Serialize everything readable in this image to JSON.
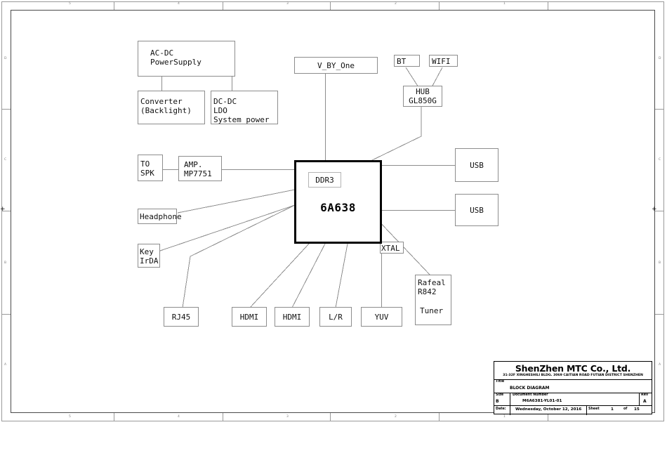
{
  "sheet": {
    "frame": {
      "columns": [
        "5",
        "4",
        "3",
        "2",
        "1"
      ],
      "rows": [
        "D",
        "C",
        "B",
        "A"
      ]
    }
  },
  "diagram": {
    "title": "BLOCK DIAGRAM",
    "soc": {
      "name": "6A638",
      "memory_label": "DDR3"
    },
    "blocks": {
      "acdc": "AC-DC\nPowerSupply",
      "converter": "Converter\n(Backlight)",
      "dcdc": "DC-DC\nLDO\nSystem power",
      "vbyone": "V_BY_One",
      "bt": "BT",
      "wifi": "WIFI",
      "hub": "HUB\nGL850G",
      "to_spk": "TO\nSPK",
      "amp": "AMP.\nMP7751",
      "headphone": "Headphone",
      "key_irda": "Key\nIrDA",
      "rj45": "RJ45",
      "hdmi1": "HDMI",
      "hdmi2": "HDMI",
      "lr": "L/R",
      "yuv": "YUV",
      "usb1": "USB",
      "usb2": "USB",
      "xtal": "XTAL",
      "tuner_name": "Rafeal\nR842",
      "tuner_type": "Tuner"
    }
  },
  "title_block": {
    "company": "ShenZhen MTC Co., Ltd.",
    "address": "31-32F XINGHESHILI BLDG. 3069 CAITIAN ROAD FUTIAN DISTRICT SHENZHEN",
    "title_label": "Title",
    "title_value": "BLOCK DIAGRAM",
    "size_label": "Size",
    "size_value": "B",
    "docnum_label": "Document Number",
    "docnum_value": "M6A6381-YL01-01",
    "rev_label": "Rev",
    "rev_value": "A",
    "date_label": "Date:",
    "date_value": "Wednesday, October 12, 2016",
    "sheet_label": "Sheet",
    "sheet_value": "1",
    "of_label": "of",
    "total_value": "15"
  }
}
